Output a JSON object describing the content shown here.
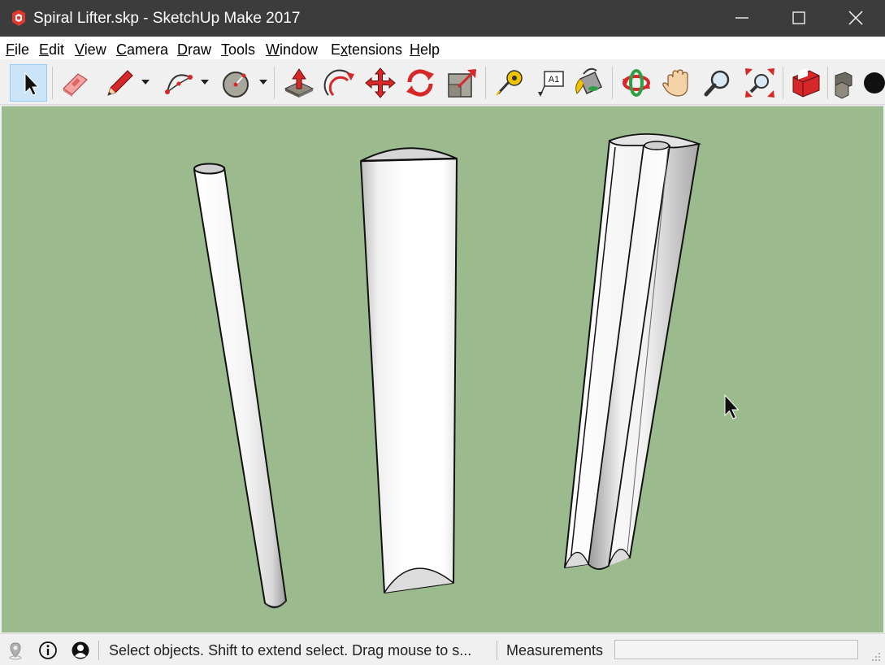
{
  "window": {
    "title": "Spiral Lifter.skp - SketchUp Make 2017",
    "controls": [
      "minimize-icon",
      "maximize-icon",
      "close-icon"
    ]
  },
  "menu": {
    "items": [
      {
        "label": "File",
        "accel": "F"
      },
      {
        "label": "Edit",
        "accel": "E"
      },
      {
        "label": "View",
        "accel": "V"
      },
      {
        "label": "Camera",
        "accel": "C"
      },
      {
        "label": "Draw",
        "accel": "D"
      },
      {
        "label": "Tools",
        "accel": "T"
      },
      {
        "label": "Window",
        "accel": "W"
      },
      {
        "label": "Extensions",
        "accel": "x"
      },
      {
        "label": "Help",
        "accel": "H"
      }
    ]
  },
  "toolbar": {
    "tools": [
      {
        "name": "select",
        "icon": "arrow-cursor-icon",
        "active": true
      },
      {
        "name": "eraser",
        "icon": "eraser-icon"
      },
      {
        "name": "line",
        "icon": "pencil-icon",
        "dropdown": true
      },
      {
        "name": "arc",
        "icon": "arc-icon",
        "dropdown": true
      },
      {
        "name": "shapes",
        "icon": "circle-icon",
        "dropdown": true
      },
      {
        "name": "push-pull",
        "icon": "push-pull-icon"
      },
      {
        "name": "offset",
        "icon": "offset-icon"
      },
      {
        "name": "move",
        "icon": "move-arrows-icon"
      },
      {
        "name": "rotate",
        "icon": "rotate-icon"
      },
      {
        "name": "scale",
        "icon": "scale-icon"
      },
      {
        "name": "tape-measure",
        "icon": "tape-measure-icon"
      },
      {
        "name": "text",
        "icon": "text-label-icon",
        "text_glyph": "A1"
      },
      {
        "name": "paint-bucket",
        "icon": "paint-bucket-icon"
      },
      {
        "name": "orbit",
        "icon": "orbit-icon"
      },
      {
        "name": "pan",
        "icon": "hand-icon"
      },
      {
        "name": "zoom",
        "icon": "magnifier-icon"
      },
      {
        "name": "zoom-extents",
        "icon": "zoom-extents-icon"
      },
      {
        "name": "warehouse",
        "icon": "3d-warehouse-icon"
      },
      {
        "name": "components",
        "icon": "components-icon"
      }
    ]
  },
  "viewport": {
    "background": "#9bbb8e",
    "objects": [
      "thin-cylinder",
      "half-cylinder",
      "grooved-cylinder"
    ],
    "cursor": "arrow-cursor-icon"
  },
  "status": {
    "icons": [
      "geo-location-icon",
      "info-icon",
      "user-icon"
    ],
    "message": "Select objects. Shift to extend select. Drag mouse to s...",
    "measurements_label": "Measurements",
    "measurements_value": ""
  },
  "colors": {
    "titlebar": "#3c3c3c",
    "viewport_bg": "#9bbb8e",
    "active_tool": "#cce4f7",
    "sketchup_red": "#e03a2f"
  }
}
